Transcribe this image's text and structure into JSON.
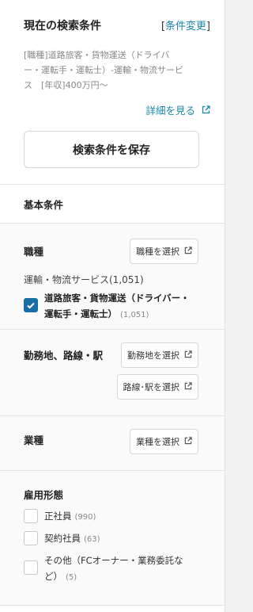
{
  "conditions": {
    "title": "現在の検索条件",
    "change_open": "[",
    "change_label": "条件変更",
    "change_close": "]",
    "desc_lines": [
      "[職種]道路旅客・貨物運送（ドライバ",
      "ー・運転手・運転士）-運輸・物流サービ",
      "ス　[年収]400万円〜"
    ],
    "detail_label": "詳細を見る",
    "save_button": "検索条件を保存"
  },
  "basic_heading": "基本条件",
  "job_type": {
    "label": "職種",
    "select_button": "職種を選択",
    "summary": "運輸・物流サービス(1,051)",
    "checked_item_line1": "道路旅客・貨物運送（ドライバー・",
    "checked_item_line2": "運転手・運転士）",
    "checked_item_count": "(1,051)"
  },
  "location": {
    "label": "勤務地、路線・駅",
    "area_button": "勤務地を選択",
    "station_button": "路線･駅を選択"
  },
  "industry": {
    "label": "業種",
    "select_button": "業種を選択"
  },
  "employment": {
    "label": "雇用形態",
    "options": [
      {
        "label": "正社員",
        "count": "(990)"
      },
      {
        "label": "契約社員",
        "count": "(63)"
      },
      {
        "label_line1": "その他（FCオーナー・業務委託な",
        "label_line2": "ど）",
        "count": "(5)"
      }
    ]
  },
  "colors": {
    "link": "#1a86a8",
    "checkbox": "#1a6ea8",
    "section_bg": "#fafafa"
  },
  "icons": [
    "external-link-icon",
    "checkmark-icon"
  ]
}
